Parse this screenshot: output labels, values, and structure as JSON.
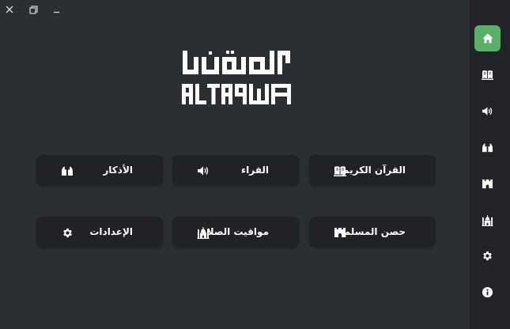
{
  "window": {
    "controls": [
      "close-icon",
      "restore-icon",
      "minimize-icon"
    ]
  },
  "logo": {
    "latin_text": "ALTAQWA",
    "arabic_text": "التقوى"
  },
  "sidebar": {
    "items": [
      {
        "icon": "home-icon",
        "active": true
      },
      {
        "icon": "quran-book-icon",
        "active": false
      },
      {
        "icon": "speaker-icon",
        "active": false
      },
      {
        "icon": "praying-hands-icon",
        "active": false
      },
      {
        "icon": "fortress-icon",
        "active": false
      },
      {
        "icon": "mosque-icon",
        "active": false
      },
      {
        "icon": "gear-icon",
        "active": false
      },
      {
        "icon": "info-icon",
        "active": false
      }
    ]
  },
  "main": {
    "cards": [
      {
        "label": "القرآن الكريم",
        "icon": "quran-book-icon"
      },
      {
        "label": "القراء",
        "icon": "speaker-icon"
      },
      {
        "label": "الأذكار",
        "icon": "praying-hands-icon"
      },
      {
        "label": "حصن المسلم",
        "icon": "fortress-icon"
      },
      {
        "label": "مواقيت الصلاة",
        "icon": "mosque-icon"
      },
      {
        "label": "الإعدادات",
        "icon": "gear-icon"
      }
    ]
  },
  "colors": {
    "background": "#2b2e33",
    "sidebar": "#212327",
    "card": "#202226",
    "accent": "#5aaf6a",
    "text": "#ffffff"
  }
}
